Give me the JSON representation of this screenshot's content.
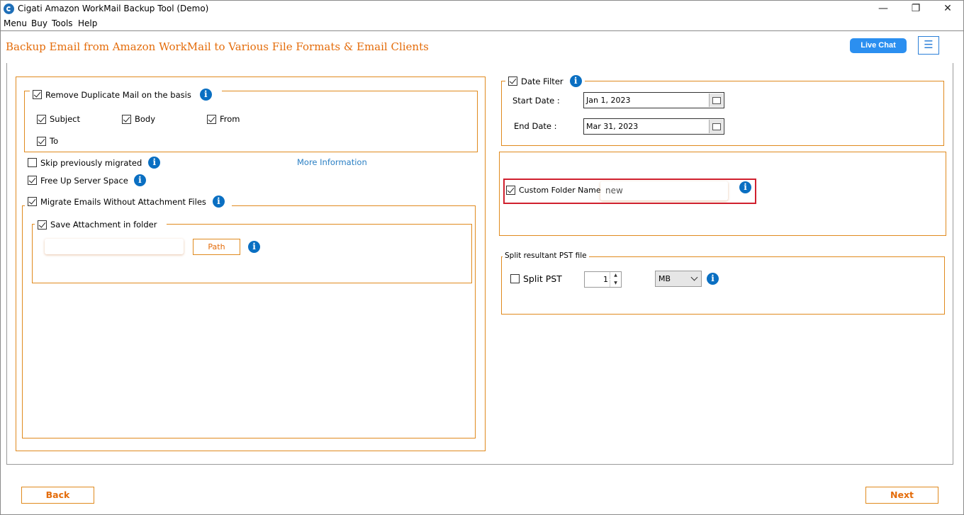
{
  "window": {
    "title": "Cigati Amazon WorkMail Backup Tool (Demo)",
    "controls": {
      "minimize": "—",
      "restore": "❐",
      "close": "✕"
    }
  },
  "menu": [
    "Menu",
    "Buy",
    "Tools",
    "Help"
  ],
  "header": {
    "title": "Backup Email from Amazon WorkMail to Various File Formats & Email Clients",
    "live_chat": "Live Chat",
    "hamburger": "☰"
  },
  "left": {
    "remove_duplicate": {
      "label": "Remove Duplicate Mail on the basis",
      "checked": true
    },
    "dup_options": [
      {
        "label": "Subject",
        "checked": true
      },
      {
        "label": "Body",
        "checked": true
      },
      {
        "label": "From",
        "checked": true
      },
      {
        "label": "To",
        "checked": true
      }
    ],
    "skip_migrated": {
      "label": "Skip previously migrated",
      "checked": false
    },
    "more_info": "More Information",
    "free_up": {
      "label": "Free Up Server Space",
      "checked": true
    },
    "migrate_without": {
      "label": "Migrate Emails Without Attachment Files",
      "checked": true
    },
    "save_attachment": {
      "label": "Save Attachment in folder",
      "checked": true
    },
    "path_value": "",
    "path_button": "Path"
  },
  "right": {
    "date_filter": {
      "label": "Date Filter",
      "checked": true
    },
    "start_label": "Start Date :",
    "start_value": "Jan 1, 2023",
    "end_label": "End Date :",
    "end_value": "Mar 31, 2023",
    "custom_folder": {
      "label": "Custom Folder Name",
      "checked": true,
      "value": "new"
    },
    "split_group": "Split resultant PST file",
    "split_pst": {
      "label": "Split PST",
      "checked": false
    },
    "split_size": "1",
    "split_unit": "MB"
  },
  "footer": {
    "back": "Back",
    "next": "Next"
  },
  "colors": {
    "accent": "#e46c0a",
    "border": "#e08a1e",
    "info": "#0a6fc2",
    "highlight": "#d0202e",
    "chat": "#2b8ff0"
  },
  "icons": {
    "info": "i"
  }
}
